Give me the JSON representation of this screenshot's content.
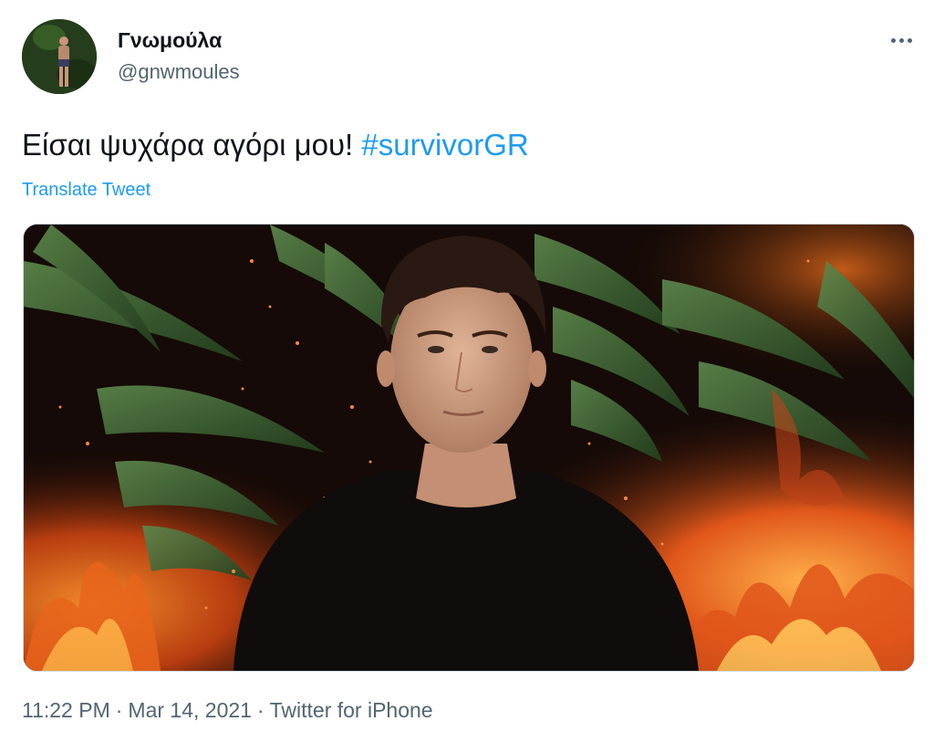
{
  "author": {
    "display_name": "Γνωμούλα",
    "handle": "@gnwmoules"
  },
  "tweet": {
    "text": "Είσαι ψυχάρα αγόρι μου!",
    "hashtag": "#survivorGR",
    "translate_label": "Translate Tweet"
  },
  "meta": {
    "time": "11:22 PM",
    "date": "Mar 14, 2021",
    "source": "Twitter for iPhone",
    "separator": "·"
  },
  "icons": {
    "more": "more-horizontal-icon"
  },
  "colors": {
    "accent": "#1d9bf0",
    "text_primary": "#0f1419",
    "text_secondary": "#536471"
  }
}
